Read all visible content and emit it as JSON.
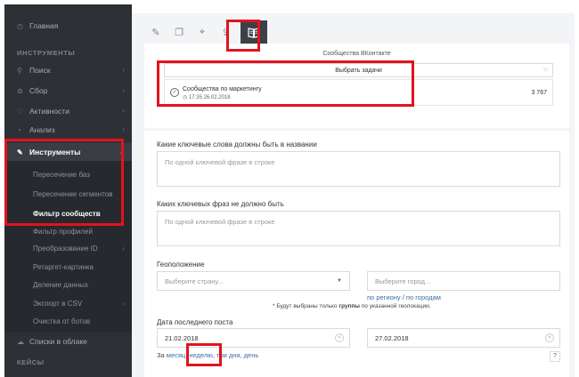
{
  "sidebar": {
    "home": "Главная",
    "section_tools": "ИНСТРУМЕНТЫ",
    "items": [
      {
        "label": "Поиск"
      },
      {
        "label": "Сбор"
      },
      {
        "label": "Активности"
      },
      {
        "label": "Анализ"
      },
      {
        "label": "Инструменты"
      }
    ],
    "sub_items": [
      {
        "label": "Пересечение баз"
      },
      {
        "label": "Пересечение сегментов"
      },
      {
        "label": "Фильтр сообществ"
      },
      {
        "label": "Фильтр профилей"
      },
      {
        "label": "Преобразование ID"
      },
      {
        "label": "Ретаргет-картинка"
      },
      {
        "label": "Деление данных"
      },
      {
        "label": "Экспорт в CSV"
      },
      {
        "label": "Очистка от ботов"
      }
    ],
    "cloud_lists": "Списки в облаке",
    "section_cases": "КЕЙСЫ"
  },
  "task_panel": {
    "title": "Сообщества ВКонтакте",
    "select_tasks": "Выбрать задачи",
    "task_name": "Сообщества по маркетингу",
    "task_time": "17:35 26.02.2018",
    "task_count": "3 767"
  },
  "form": {
    "kw_include_label": "Какие ключевые слова должны быть в названии",
    "kw_include_placeholder": "По одной ключевой фразе в строке",
    "kw_exclude_label": "Каких ключевых фраз не должно быть",
    "kw_exclude_placeholder": "По одной ключевой фразе в строке",
    "geo_label": "Геоположение",
    "country_placeholder": "Выберите страну...",
    "city_placeholder": "Выберите город...",
    "by_region": "по региону",
    "slash": " / ",
    "by_cities": "по городам",
    "geo_note_prefix": "* Будут выбраны только ",
    "geo_note_bold": "группы",
    "geo_note_suffix": " по указанной геолокации.",
    "last_post_label": "Дата последнего поста",
    "date_from": "21.02.2018",
    "date_to": "27.02.2018",
    "period_prefix": "За ",
    "period_month": "месяц",
    "period_week": "неделю",
    "period_3days": "три дня",
    "period_day": "день",
    "help": "?"
  },
  "colors": {
    "sidebar_bg": "#2d3035",
    "highlight": "#e0141e",
    "link": "#3d6ca8"
  }
}
